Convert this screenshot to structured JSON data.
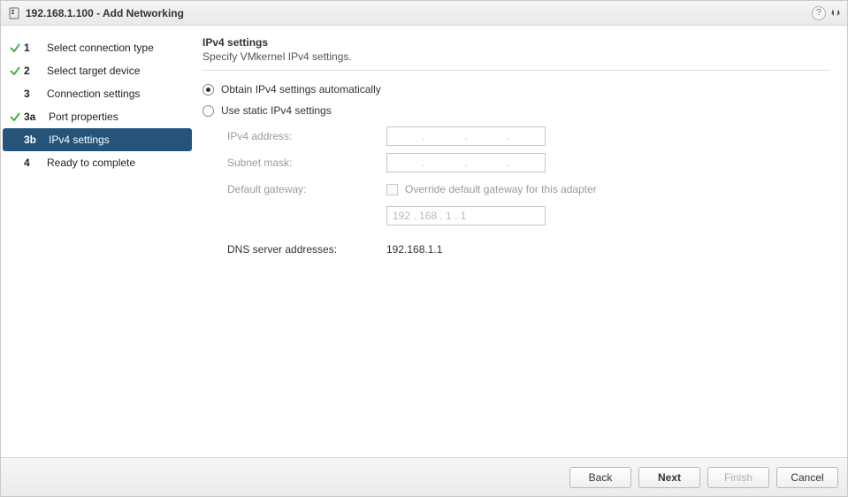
{
  "titlebar": {
    "title": "192.168.1.100 - Add Networking"
  },
  "sidebar": {
    "items": [
      {
        "n": "1",
        "label": "Select connection type",
        "done": true,
        "sub": false,
        "selected": false
      },
      {
        "n": "2",
        "label": "Select target device",
        "done": true,
        "sub": false,
        "selected": false
      },
      {
        "n": "3",
        "label": "Connection settings",
        "done": false,
        "sub": false,
        "selected": false
      },
      {
        "n": "3a",
        "label": "Port properties",
        "done": true,
        "sub": true,
        "selected": false
      },
      {
        "n": "3b",
        "label": "IPv4 settings",
        "done": false,
        "sub": true,
        "selected": true
      },
      {
        "n": "4",
        "label": "Ready to complete",
        "done": false,
        "sub": false,
        "selected": false
      }
    ]
  },
  "content": {
    "title": "IPv4 settings",
    "subtitle": "Specify VMkernel IPv4 settings.",
    "radio_auto": "Obtain IPv4 settings automatically",
    "radio_static": "Use static IPv4 settings",
    "form": {
      "ipv4_label": "IPv4 address:",
      "subnet_label": "Subnet mask:",
      "gateway_label": "Default gateway:",
      "gateway_override": "Override default gateway for this adapter",
      "gateway_value": "192 . 168 .   1  .   1",
      "dns_label": "DNS server addresses:",
      "dns_value": "192.168.1.1"
    }
  },
  "footer": {
    "back": "Back",
    "next": "Next",
    "finish": "Finish",
    "cancel": "Cancel"
  }
}
